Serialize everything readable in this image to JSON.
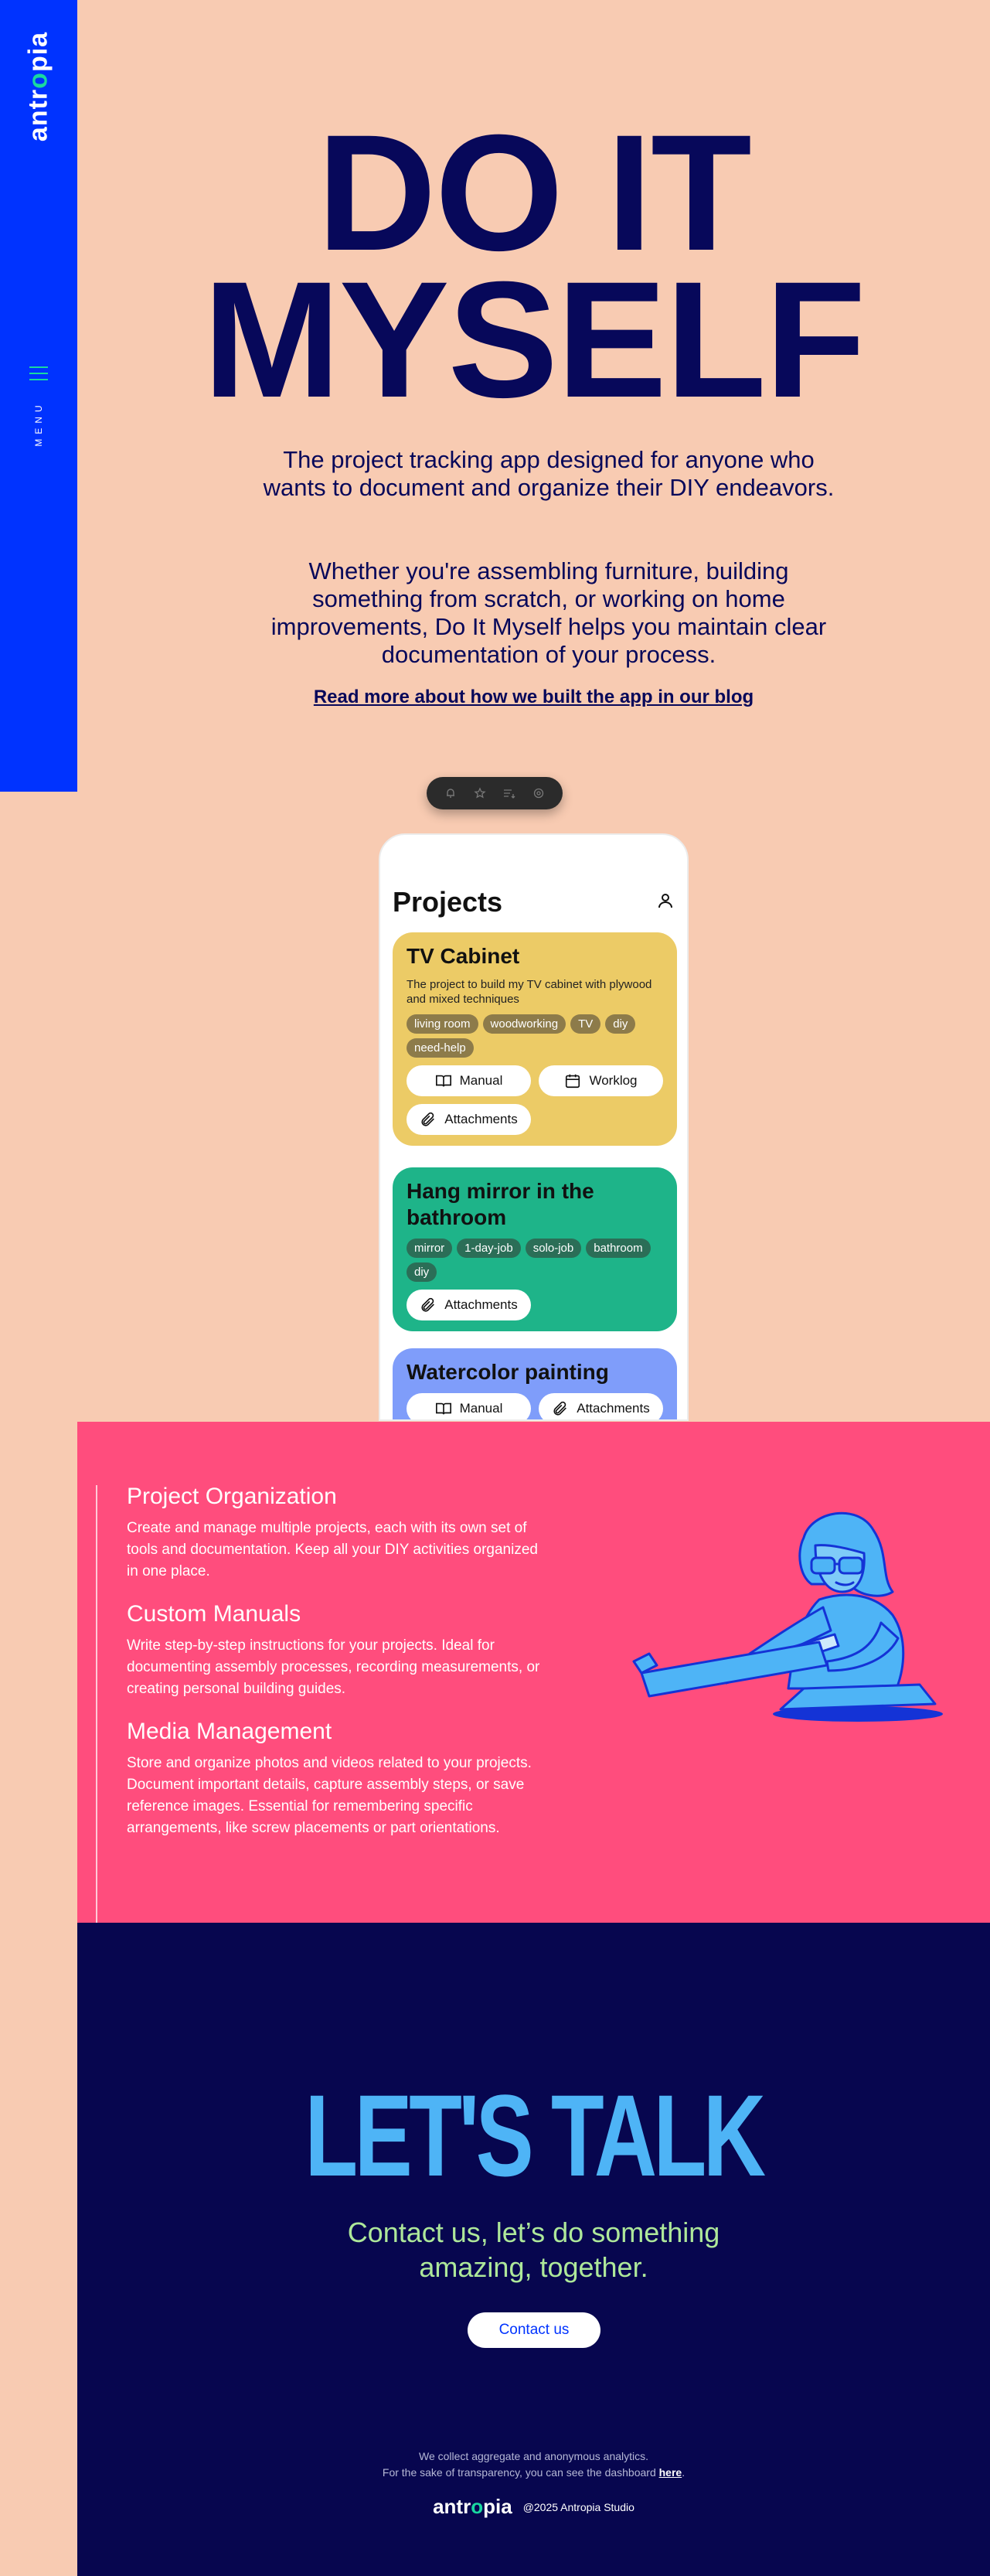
{
  "brand": {
    "name_start": "antr",
    "name_o": "o",
    "name_end": "pia"
  },
  "nav": {
    "menu_label": "MENU"
  },
  "hero": {
    "title_line1": "DO IT",
    "title_line2": "MYSELF",
    "paragraph1": "The project tracking app designed for anyone who wants to document and organize their DIY endeavors.",
    "paragraph2": "Whether you're assembling furniture, building something from scratch, or working on home improvements, Do It Myself helps you maintain clear documentation of your process.",
    "blog_link": "Read more about how we built the app in our blog"
  },
  "app": {
    "title": "Projects",
    "projects": [
      {
        "title": "TV Cabinet",
        "description": "The project to build my TV cabinet with plywood and mixed techniques",
        "tags": [
          "living room",
          "woodworking",
          "TV",
          "diy",
          "need-help"
        ],
        "buttons": [
          "Manual",
          "Worklog",
          "Attachments"
        ],
        "color": "#eccb66"
      },
      {
        "title": "Hang mirror in the bathroom",
        "tags": [
          "mirror",
          "1-day-job",
          "solo-job",
          "bathroom",
          "diy"
        ],
        "buttons": [
          "Attachments"
        ],
        "color": "#1eb489"
      },
      {
        "title": "Watercolor painting",
        "buttons": [
          "Manual",
          "Attachments"
        ],
        "color": "#7f9dfa"
      }
    ]
  },
  "features": [
    {
      "title": "Project Organization",
      "text": "Create and manage multiple projects, each with its own set of tools and documentation. Keep all your DIY activities organized in one place."
    },
    {
      "title": "Custom Manuals",
      "text": "Write step-by-step instructions for your projects. Ideal for documenting assembly processes, recording measurements, or creating personal building guides."
    },
    {
      "title": "Media Management",
      "text": "Store and organize photos and videos related to your projects. Document important details, capture assembly steps, or save reference images. Essential for remembering specific arrangements, like screw placements or part orientations."
    }
  ],
  "contact": {
    "headline": "LET'S TALK",
    "subtitle_line1": "Contact us, let’s do something",
    "subtitle_line2": "amazing, together.",
    "button": "Contact us"
  },
  "footer": {
    "analytics_line1": "We collect aggregate and anonymous analytics.",
    "analytics_line2": "For the sake of transparency, you can see the dashboard ",
    "analytics_link": "here",
    "analytics_end": ".",
    "copyright": "@2025 Antropia Studio"
  },
  "colors": {
    "background": "#f8cbb2",
    "sidebar": "#0033ff",
    "accent_green": "#19d8a0",
    "hero_text": "#07085a",
    "features_bg": "#ff4d7d",
    "contact_bg": "#07064f",
    "lets_talk": "#4eb4f6",
    "contact_sub": "#aee89a"
  }
}
